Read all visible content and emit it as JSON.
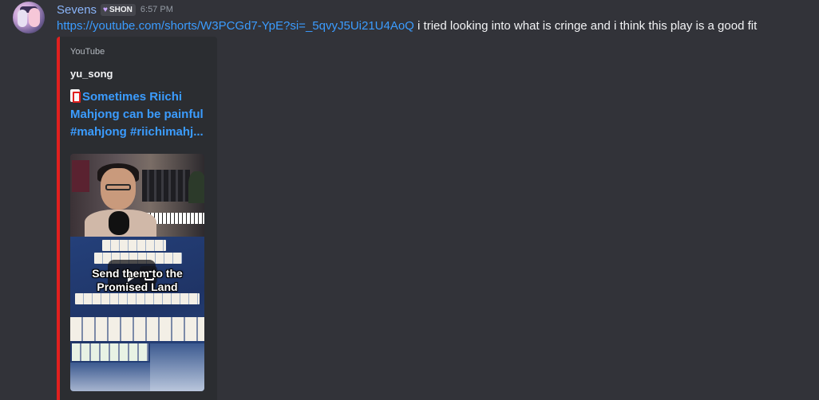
{
  "message": {
    "username": "Sevens",
    "clan_tag": "SHON",
    "clan_icon": "heart-icon",
    "timestamp": "6:57 PM",
    "link": "https://youtube.com/shorts/W3PCGd7-YpE?si=_5qvyJ5Ui21U4AoQ",
    "text": " i tried looking into what is cringe and i think this play is a good fit"
  },
  "embed": {
    "accent_color": "#e0201f",
    "provider": "YouTube",
    "author": "yu_song",
    "title_emoji": "mahjong-tile-emoji",
    "title_lines": [
      "Sometimes Riichi",
      "Mahjong can be painful",
      "#mahjong #riichimahj..."
    ],
    "video_caption_lines": [
      "Send them to the",
      "Promised Land"
    ]
  },
  "colors": {
    "background": "#323339",
    "link": "#3b9cff",
    "username": "#8ab4f8"
  }
}
